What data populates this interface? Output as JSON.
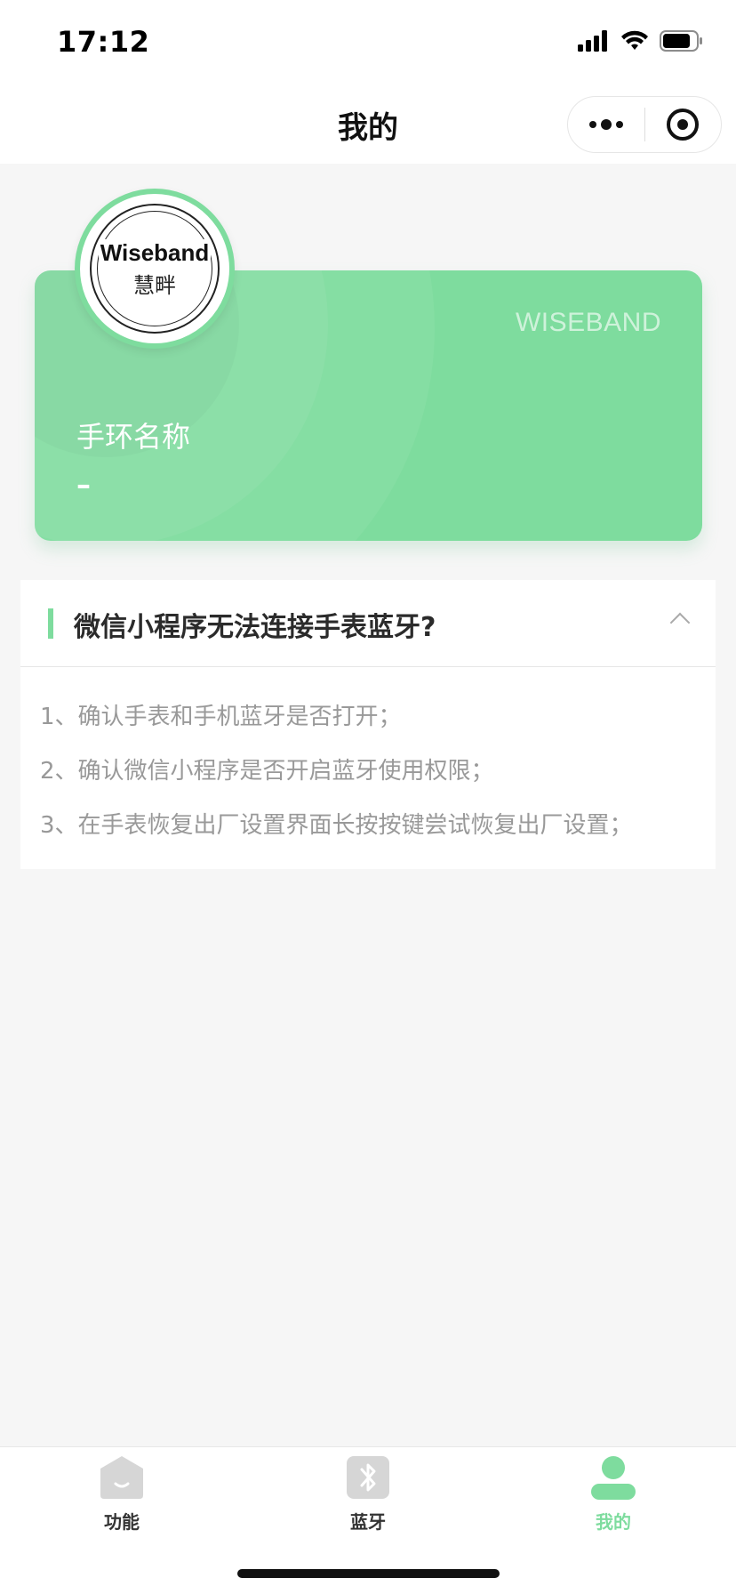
{
  "status_bar": {
    "time": "17:12",
    "icons": [
      "signal-icon",
      "wifi-icon",
      "battery-icon"
    ]
  },
  "nav": {
    "title": "我的",
    "capsule_icons": [
      "more-icon",
      "close-target-icon"
    ]
  },
  "band_card": {
    "brand": "WISEBAND",
    "name_label": "手环名称",
    "name_value": "–",
    "logo_text_en": "Wiseband",
    "logo_text_cn": "慧畔",
    "color": "#7edc9e"
  },
  "faq": {
    "title": "微信小程序无法连接手表蓝牙?",
    "expanded": true,
    "items": [
      "1、确认手表和手机蓝牙是否打开；",
      "2、确认微信小程序是否开启蓝牙使用权限；",
      "3、在手表恢复出厂设置界面长按按键尝试恢复出厂设置；"
    ]
  },
  "tab_bar": {
    "tabs": [
      {
        "label": "功能",
        "icon": "home-icon",
        "active": false
      },
      {
        "label": "蓝牙",
        "icon": "bluetooth-icon",
        "active": false
      },
      {
        "label": "我的",
        "icon": "profile-icon",
        "active": true
      }
    ],
    "active_color": "#7edc9e"
  }
}
